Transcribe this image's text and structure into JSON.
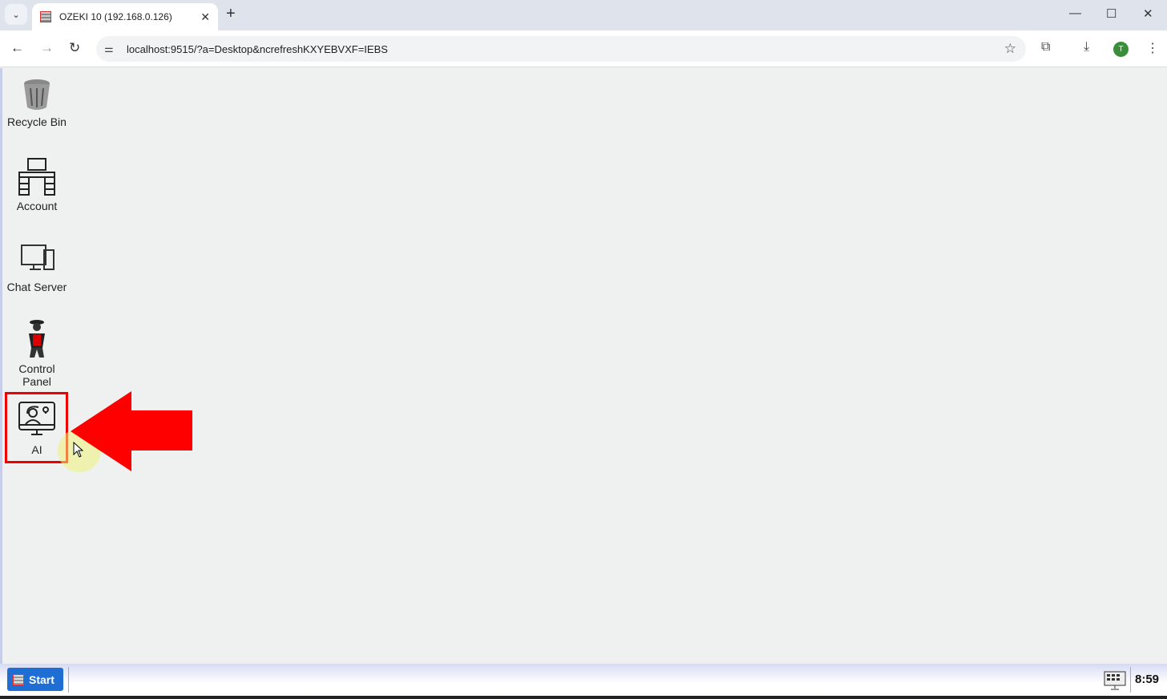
{
  "browser": {
    "tab_title": "OZEKI 10 (192.168.0.126)",
    "url": "localhost:9515/?a=Desktop&ncrefreshKXYEBVXF=IEBS",
    "profile_initial": "T"
  },
  "desktop": {
    "icons": [
      {
        "label": "Recycle Bin",
        "icon": "recycle-bin-icon"
      },
      {
        "label": "Account",
        "icon": "account-desk-icon"
      },
      {
        "label": "Chat Server",
        "icon": "chat-server-icon"
      },
      {
        "label": "Control Panel",
        "icon": "control-panel-icon"
      },
      {
        "label": "AI",
        "icon": "ai-monitor-icon",
        "highlighted": true
      }
    ],
    "annotation_color": "#ff0000"
  },
  "taskbar": {
    "start_label": "Start",
    "clock": "8:59"
  }
}
